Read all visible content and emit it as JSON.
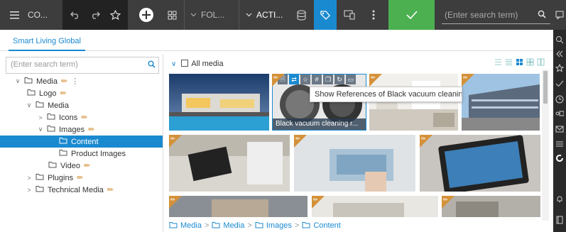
{
  "toolbar": {
    "menu_label": "CO...",
    "folder_label": "FOL...",
    "action_label": "ACTI...",
    "search_placeholder": "(Enter search term)"
  },
  "tabs": [
    {
      "label": "Smart Living Global"
    }
  ],
  "tree": {
    "search_placeholder": "(Enter search term)",
    "items": [
      {
        "label": "Media"
      },
      {
        "label": "Logo"
      },
      {
        "label": "Media"
      },
      {
        "label": "Icons"
      },
      {
        "label": "Images"
      },
      {
        "label": "Content"
      },
      {
        "label": "Product Images"
      },
      {
        "label": "Video"
      },
      {
        "label": "Plugins"
      },
      {
        "label": "Technical Media"
      }
    ]
  },
  "main": {
    "header_label": "All media",
    "selected_caption": "Black vacuum cleaning r...",
    "tooltip": "Show References of Black vacuum cleaning...",
    "breadcrumb": [
      "Media",
      "Media",
      "Images",
      "Content"
    ]
  },
  "colors": {
    "accent": "#1a8ad0",
    "pencil": "#d4913a",
    "toolbar": "#3d3d3d",
    "confirm": "#4caf50"
  }
}
